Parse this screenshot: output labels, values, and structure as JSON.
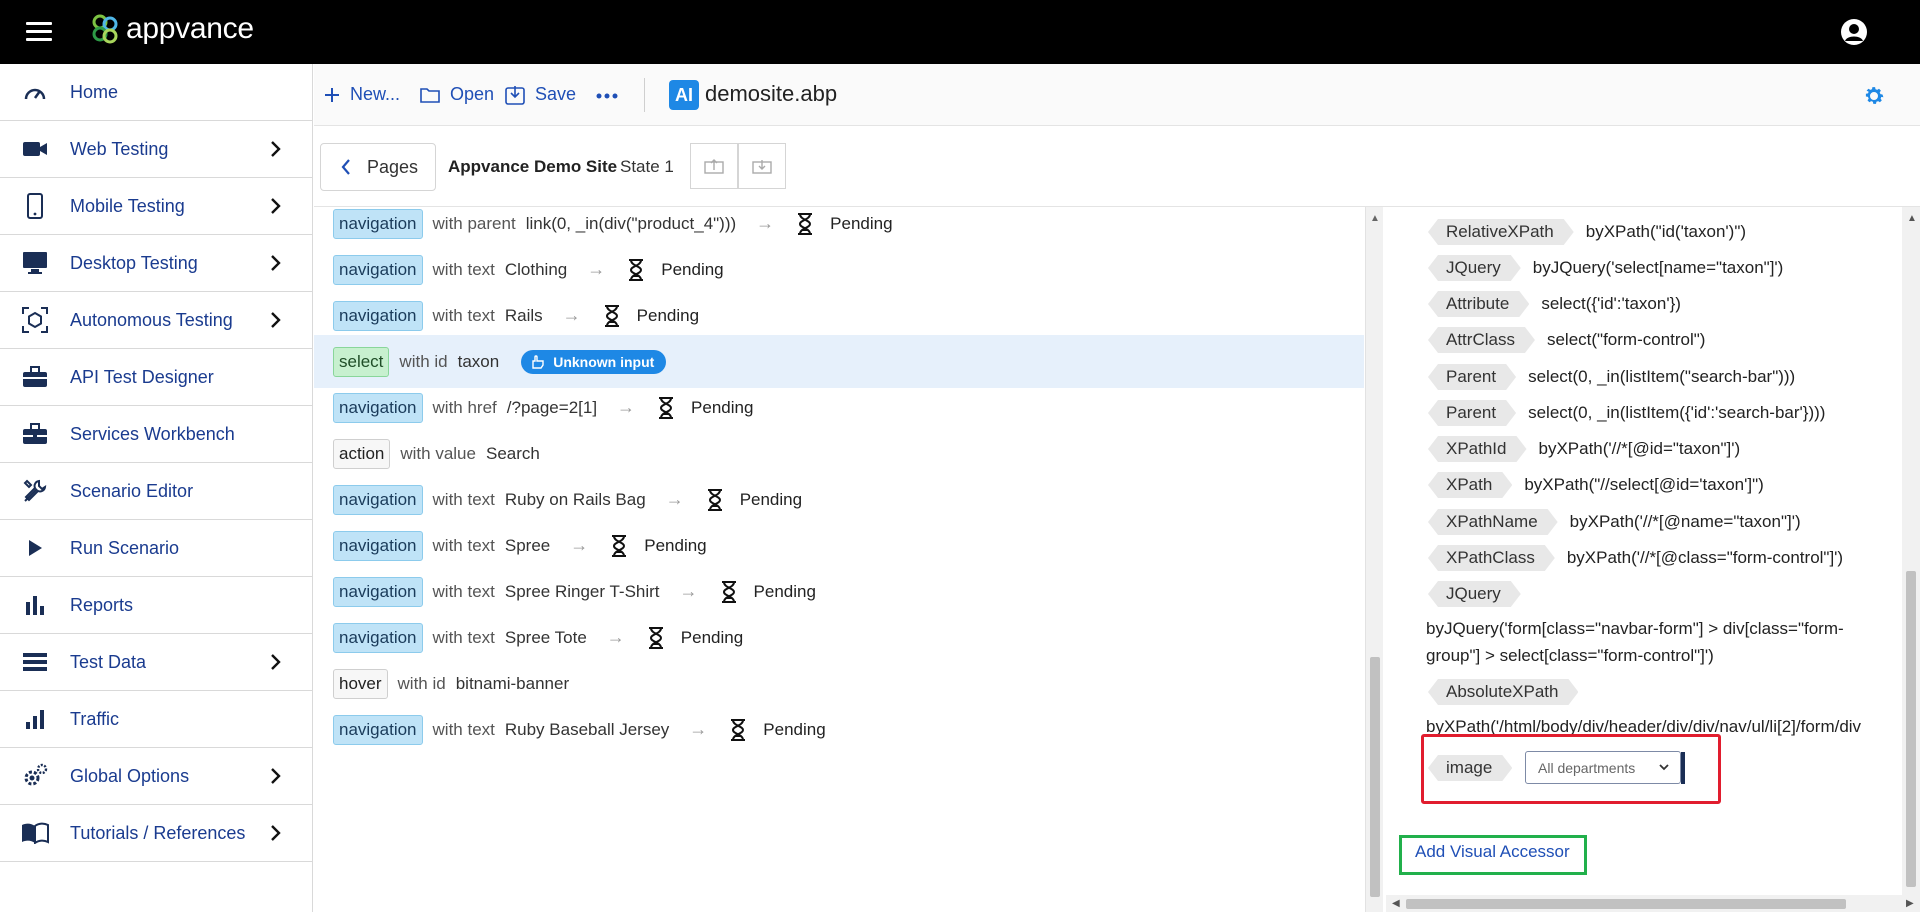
{
  "app": {
    "logo_text": "appvance"
  },
  "sidebar": {
    "items": [
      {
        "label": "Home",
        "icon": "speedometer-icon",
        "has_chevron": false
      },
      {
        "label": "Web Testing",
        "icon": "video-camera-icon",
        "has_chevron": true
      },
      {
        "label": "Mobile Testing",
        "icon": "smartphone-icon",
        "has_chevron": true
      },
      {
        "label": "Desktop Testing",
        "icon": "monitor-icon",
        "has_chevron": true
      },
      {
        "label": "Autonomous Testing",
        "icon": "cube-scan-icon",
        "has_chevron": true
      },
      {
        "label": "API Test Designer",
        "icon": "briefcase-icon",
        "has_chevron": false
      },
      {
        "label": "Services Workbench",
        "icon": "toolbox-icon",
        "has_chevron": false
      },
      {
        "label": "Scenario Editor",
        "icon": "tools-icon",
        "has_chevron": false
      },
      {
        "label": "Run Scenario",
        "icon": "play-icon",
        "has_chevron": false
      },
      {
        "label": "Reports",
        "icon": "bar-chart-icon",
        "has_chevron": false
      },
      {
        "label": "Test Data",
        "icon": "list-icon",
        "has_chevron": true
      },
      {
        "label": "Traffic",
        "icon": "signal-bars-icon",
        "has_chevron": false
      },
      {
        "label": "Global Options",
        "icon": "gears-icon",
        "has_chevron": true
      },
      {
        "label": "Tutorials / References",
        "icon": "book-icon",
        "has_chevron": true
      }
    ]
  },
  "toolbar": {
    "new_label": "New...",
    "open_label": "Open",
    "save_label": "Save",
    "file_badge": "AI",
    "file_name": "demosite.abp"
  },
  "pagesbar": {
    "pages_label": "Pages",
    "site_name": "Appvance Demo Site",
    "state_name": "State 1"
  },
  "steps": [
    {
      "type": "navigation",
      "style": "navigation",
      "kind": "with parent",
      "value": "link(0, _in(div(\"product_4\")))",
      "status": "Pending"
    },
    {
      "type": "navigation",
      "style": "navigation",
      "kind": "with text",
      "value": "Clothing",
      "status": "Pending"
    },
    {
      "type": "navigation",
      "style": "navigation",
      "kind": "with text",
      "value": "Rails",
      "status": "Pending"
    },
    {
      "type": "select",
      "style": "select",
      "kind": "with id",
      "value": "taxon",
      "badge": "Unknown input",
      "selected": true
    },
    {
      "type": "navigation",
      "style": "navigation",
      "kind": "with href",
      "value": "/?page=2[1]",
      "status": "Pending"
    },
    {
      "type": "action",
      "style": "plain",
      "kind": "with value",
      "value": "Search"
    },
    {
      "type": "navigation",
      "style": "navigation",
      "kind": "with text",
      "value": "Ruby on Rails Bag",
      "status": "Pending"
    },
    {
      "type": "navigation",
      "style": "navigation",
      "kind": "with text",
      "value": "Spree",
      "status": "Pending"
    },
    {
      "type": "navigation",
      "style": "navigation",
      "kind": "with text",
      "value": "Spree Ringer T-Shirt",
      "status": "Pending"
    },
    {
      "type": "navigation",
      "style": "navigation",
      "kind": "with text",
      "value": "Spree Tote",
      "status": "Pending"
    },
    {
      "type": "hover",
      "style": "plain",
      "kind": "with id",
      "value": "bitnami-banner"
    },
    {
      "type": "navigation",
      "style": "navigation",
      "kind": "with text",
      "value": "Ruby Baseball Jersey",
      "status": "Pending"
    }
  ],
  "accessors": [
    {
      "tag": "RelativeXPath",
      "value": "byXPath(\"id('taxon')\")"
    },
    {
      "tag": "JQuery",
      "value": "byJQuery('select[name=\"taxon\"]')"
    },
    {
      "tag": "Attribute",
      "value": "select({'id':'taxon'})"
    },
    {
      "tag": "AttrClass",
      "value": "select(\"form-control\")"
    },
    {
      "tag": "Parent",
      "value": "select(0, _in(listItem(\"search-bar\")))"
    },
    {
      "tag": "Parent",
      "value": "select(0, _in(listItem({'id':'search-bar'})))"
    },
    {
      "tag": "XPathId",
      "value": "byXPath('//*[@id=\"taxon\"]')"
    },
    {
      "tag": "XPath",
      "value": "byXPath(\"//select[@id='taxon']\")"
    },
    {
      "tag": "XPathName",
      "value": "byXPath('//*[@name=\"taxon\"]')"
    },
    {
      "tag": "XPathClass",
      "value": "byXPath('//*[@class=\"form-control\"]')"
    }
  ],
  "jquery_block": {
    "tag": "JQuery",
    "value": "byJQuery('form[class=\"navbar-form\"] > div[class=\"form-group\"] > select[class=\"form-control\"]')"
  },
  "absolute_block": {
    "tag": "AbsoluteXPath",
    "value": "byXPath('/html/body/div/header/div/div/nav/ul/li[2]/form/div"
  },
  "image_accessor": {
    "tag": "image",
    "select_text": "All departments"
  },
  "add_visual_accessor": "Add Visual Accessor",
  "colors": {
    "accent": "#1e88e5",
    "link": "#1f4fb6",
    "highlight_red": "#e11d2e",
    "highlight_green": "#21b04b"
  }
}
